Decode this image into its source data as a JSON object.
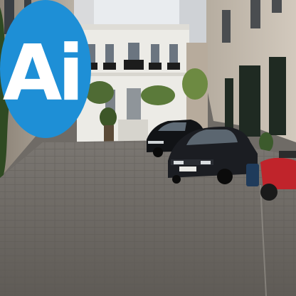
{
  "logo": {
    "text": "Ai",
    "bg_color": "#1e8fd6",
    "fg_color": "#ffffff"
  },
  "scene": {
    "sky_color": "#e9ecef",
    "facade_color": "#ecebe6",
    "paving_color": "#6d6964",
    "car_colors": [
      "#111316",
      "#1b1d22"
    ],
    "scooter_color": "#c0242b",
    "plate_text": "2648 HZ 75"
  }
}
